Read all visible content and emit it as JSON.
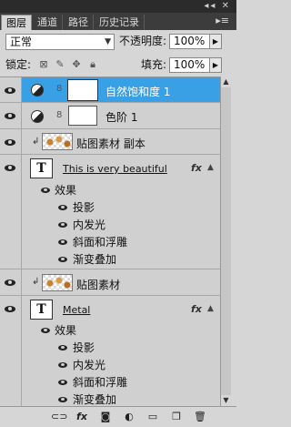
{
  "window": {
    "controls": "◂◂ ✕"
  },
  "tabs": [
    {
      "label": "图层",
      "active": true
    },
    {
      "label": "通道",
      "active": false
    },
    {
      "label": "路径",
      "active": false
    },
    {
      "label": "历史记录",
      "active": false
    }
  ],
  "tab_menu_glyph": "▸≡",
  "options": {
    "blend_mode": "正常",
    "opacity_label": "不透明度:",
    "opacity_value": "100%",
    "lock_label": "锁定:",
    "fill_label": "填充:",
    "fill_value": "100%"
  },
  "layers": [
    {
      "name": "自然饱和度 1",
      "type": "adjustment",
      "selected": true
    },
    {
      "name": "色阶 1",
      "type": "adjustment",
      "selected": false
    },
    {
      "name": "贴图素材 副本",
      "type": "image",
      "selected": false
    },
    {
      "name": "This is very beautiful",
      "type": "text",
      "selected": false,
      "effects_label": "效果",
      "effects": [
        "投影",
        "内发光",
        "斜面和浮雕",
        "渐变叠加"
      ]
    },
    {
      "name": "贴图素材",
      "type": "image",
      "selected": false
    },
    {
      "name": "Metal",
      "type": "text",
      "selected": false,
      "effects_label": "效果",
      "effects": [
        "投影",
        "内发光",
        "斜面和浮雕",
        "渐变叠加"
      ]
    }
  ],
  "fx_label": "fx",
  "text_thumb_label": "T",
  "bottom_icons": [
    "link-icon",
    "fx-icon",
    "mask-icon",
    "adjustment-icon",
    "group-icon",
    "new-layer-icon",
    "trash-icon"
  ],
  "colors": {
    "selection": "#3aa0e6",
    "panel": "#d6d6d6",
    "tabbar": "#3c3c3c"
  }
}
